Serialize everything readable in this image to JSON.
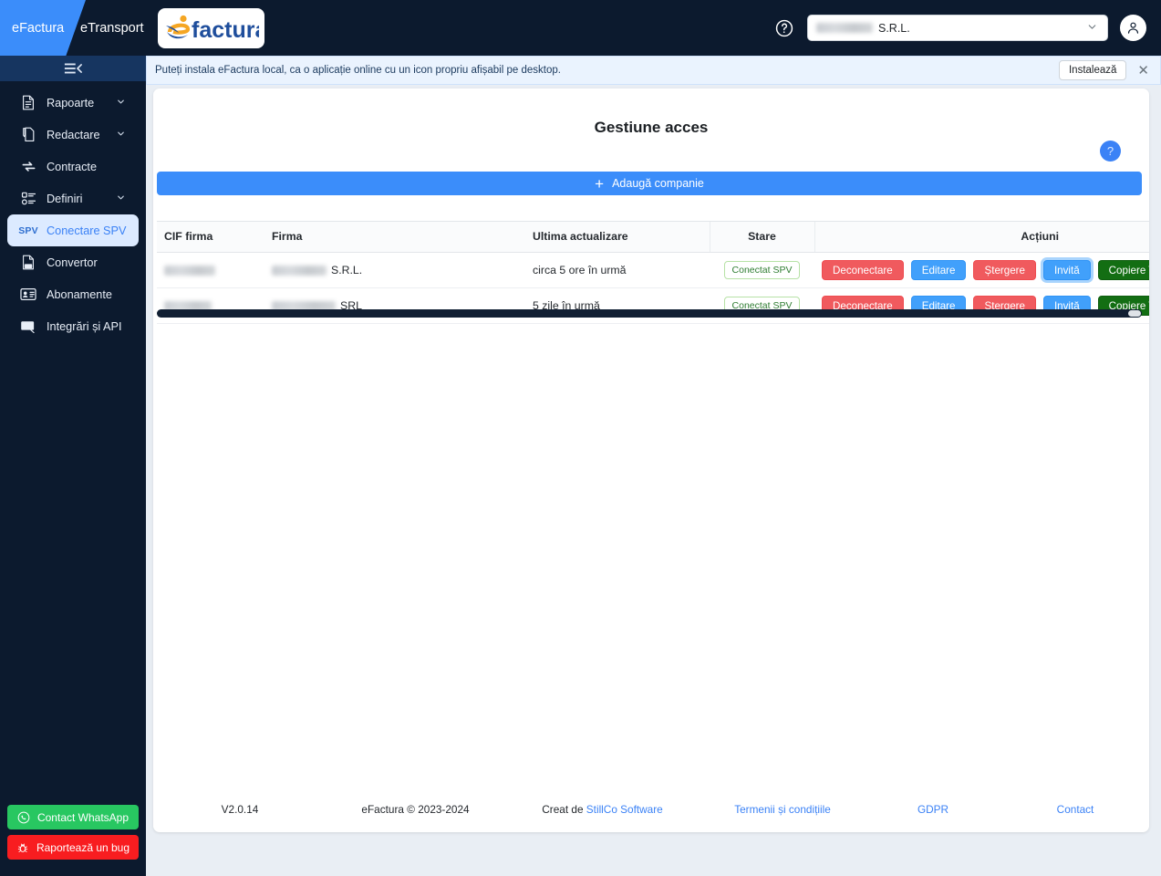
{
  "topbar": {
    "tabs": [
      {
        "label": "eFactura",
        "active": true
      },
      {
        "label": "eTransport",
        "active": false
      }
    ],
    "logo_text": "factura",
    "logo_colors": {
      "e": "#f5a623",
      "swoosh": "#1f4e9c",
      "word": "#1f4e9c"
    },
    "help_icon": "question-circle-icon",
    "company_selector": {
      "value": "S.R.L.",
      "redacted_prefix": true
    },
    "avatar_icon": "user-icon"
  },
  "sidebar": {
    "collapse_icon": "collapse-menu-icon",
    "items": [
      {
        "label": "Rapoarte",
        "icon": "report-icon",
        "chevron": true,
        "active": false
      },
      {
        "label": "Redactare",
        "icon": "edit-document-icon",
        "chevron": true,
        "active": false
      },
      {
        "label": "Contracte",
        "icon": "sync-contract-icon",
        "chevron": false,
        "active": false
      },
      {
        "label": "Definiri",
        "icon": "list-settings-icon",
        "chevron": true,
        "active": false
      },
      {
        "label": "Conectare SPV",
        "icon": "spv-icon",
        "chevron": false,
        "active": true,
        "icon_text": "SPV"
      },
      {
        "label": "Convertor",
        "icon": "pdf-convert-icon",
        "chevron": false,
        "active": false
      },
      {
        "label": "Abonamente",
        "icon": "id-card-icon",
        "chevron": false,
        "active": false
      },
      {
        "label": "Integrări și API",
        "icon": "api-icon",
        "chevron": false,
        "active": false
      }
    ],
    "whatsapp_button": {
      "label": "Contact WhatsApp",
      "icon": "whatsapp-icon",
      "color": "#28c761"
    },
    "bug_button": {
      "label": "Raportează un bug",
      "icon": "bug-icon",
      "color": "#f81d20"
    }
  },
  "banner": {
    "text": "Puteți instala eFactura local, ca o aplicație online cu un icon propriu afișabil pe desktop.",
    "install_label": "Instalează",
    "close_icon": "close-icon"
  },
  "page": {
    "title": "Gestiune acces",
    "help_badge": "?",
    "add_company_label": "Adaugă companie",
    "add_company_icon": "plus-icon"
  },
  "table": {
    "headers": [
      "CIF firma",
      "Firma",
      "Ultima actualizare",
      "Stare",
      "Acțiuni"
    ],
    "rows": [
      {
        "cif": "",
        "firma": "S.R.L.",
        "ultima_actualizare": "circa 5 ore în urmă",
        "stare": "Conectat SPV",
        "actions": [
          {
            "label": "Deconectare",
            "style": "red",
            "focused": false
          },
          {
            "label": "Editare",
            "style": "blue",
            "focused": false
          },
          {
            "label": "Ștergere",
            "style": "red",
            "focused": false
          },
          {
            "label": "Invită",
            "style": "blue",
            "focused": true
          },
          {
            "label": "Copiere Token Acces",
            "style": "green",
            "focused": false
          }
        ]
      },
      {
        "cif": "",
        "firma": "SRL",
        "ultima_actualizare": "5 zile în urmă",
        "stare": "Conectat SPV",
        "actions": [
          {
            "label": "Deconectare",
            "style": "red",
            "focused": false
          },
          {
            "label": "Editare",
            "style": "blue",
            "focused": false
          },
          {
            "label": "Ștergere",
            "style": "red",
            "focused": false
          },
          {
            "label": "Invită",
            "style": "blue",
            "focused": false
          },
          {
            "label": "Copiere Token Acces",
            "style": "green",
            "focused": false
          }
        ]
      }
    ]
  },
  "footer": {
    "version": "V2.0.14",
    "copyright": "eFactura © 2023-2024",
    "created_prefix": "Creat de ",
    "created_link": "StillCo Software",
    "terms": "Termenii și condițiile",
    "gdpr": "GDPR",
    "contact": "Contact"
  },
  "colors": {
    "dark_navy": "#0c1a2e",
    "accent_blue": "#3b8dfa",
    "danger_red": "#f05a5e",
    "success_green": "#136e13",
    "badge_green_border": "#b7e2a6",
    "badge_green_text": "#2f7d32"
  }
}
